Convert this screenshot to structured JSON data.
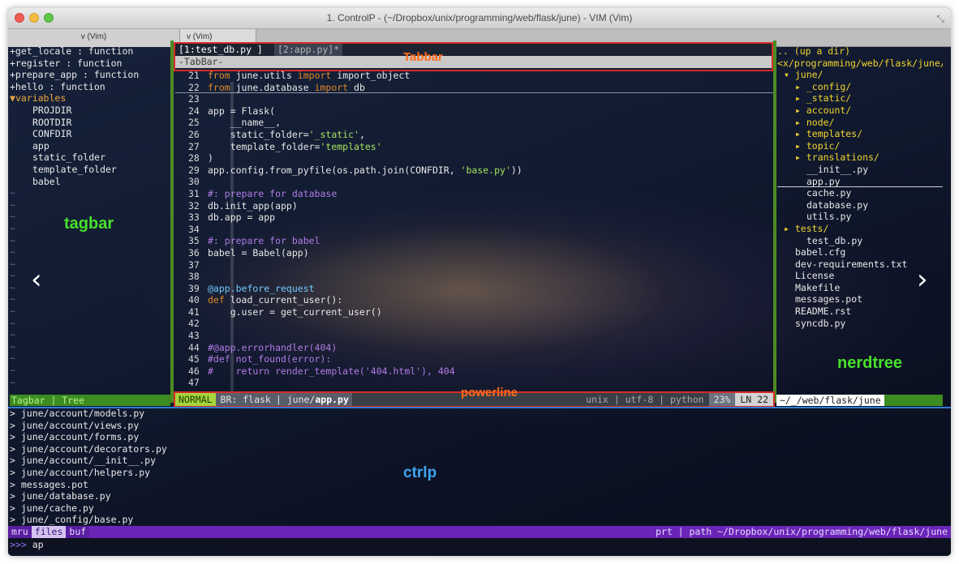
{
  "window": {
    "title": "1. ControlP - (~/Dropbox/unix/programming/web/flask/june) - VIM (Vim)",
    "tabs": [
      "v (Vim)",
      "v (Vim)"
    ]
  },
  "vim_tabs": {
    "active": "[1:test_db.py ]",
    "inactive": "[2:app.py]*",
    "tabbar_line": "-TabBar-"
  },
  "tagbar": {
    "functions": [
      "+get_locale : function",
      "+register : function",
      "+prepare_app : function",
      "+hello : function"
    ],
    "section": "variables",
    "variables": [
      "PROJDIR",
      "ROOTDIR",
      "CONFDIR",
      "app",
      "static_folder",
      "template_folder",
      "babel"
    ],
    "status": "Tagbar | Tree"
  },
  "code_lines": [
    {
      "n": "21",
      "t": "from june.utils import import_object"
    },
    {
      "n": "22",
      "t": "from june.database import db"
    },
    {
      "n": "23",
      "t": ""
    },
    {
      "n": "24",
      "t": "app = Flask("
    },
    {
      "n": "25",
      "t": "    __name__,"
    },
    {
      "n": "26",
      "t": "    static_folder='_static',"
    },
    {
      "n": "27",
      "t": "    template_folder='templates'"
    },
    {
      "n": "28",
      "t": ")"
    },
    {
      "n": "29",
      "t": "app.config.from_pyfile(os.path.join(CONFDIR, 'base.py'))"
    },
    {
      "n": "30",
      "t": ""
    },
    {
      "n": "31",
      "t": "#: prepare for database"
    },
    {
      "n": "32",
      "t": "db.init_app(app)"
    },
    {
      "n": "33",
      "t": "db.app = app"
    },
    {
      "n": "34",
      "t": ""
    },
    {
      "n": "35",
      "t": "#: prepare for babel"
    },
    {
      "n": "36",
      "t": "babel = Babel(app)"
    },
    {
      "n": "37",
      "t": ""
    },
    {
      "n": "38",
      "t": ""
    },
    {
      "n": "39",
      "t": "@app.before_request"
    },
    {
      "n": "40",
      "t": "def load_current_user():"
    },
    {
      "n": "41",
      "t": "    g.user = get_current_user()"
    },
    {
      "n": "42",
      "t": ""
    },
    {
      "n": "43",
      "t": ""
    },
    {
      "n": "44",
      "t": "#@app.errorhandler(404)"
    },
    {
      "n": "45",
      "t": "#def not_found(error):"
    },
    {
      "n": "46",
      "t": "#    return render_template('404.html'), 404"
    },
    {
      "n": "47",
      "t": ""
    }
  ],
  "powerline": {
    "mode": "NORMAL",
    "branch": "BR: flask",
    "file_dir": "june/",
    "file_name": "app.py",
    "encoding_info": "unix | utf-8 | python",
    "percent": "23%",
    "ln": "LN",
    "line_no": "22"
  },
  "nerdtree": {
    "up": ".. (up a dir)",
    "path": "<x/programming/web/flask/june/",
    "items": [
      {
        "t": "▾ june/",
        "k": "dir",
        "indent": 0
      },
      {
        "t": "▸ _config/",
        "k": "dir",
        "indent": 1
      },
      {
        "t": "▸ _static/",
        "k": "dir",
        "indent": 1
      },
      {
        "t": "▸ account/",
        "k": "dir",
        "indent": 1
      },
      {
        "t": "▸ node/",
        "k": "dir",
        "indent": 1
      },
      {
        "t": "▸ templates/",
        "k": "dir",
        "indent": 1
      },
      {
        "t": "▸ topic/",
        "k": "dir",
        "indent": 1
      },
      {
        "t": "▸ translations/",
        "k": "dir",
        "indent": 1
      },
      {
        "t": "__init__.py",
        "k": "file",
        "indent": 2
      },
      {
        "t": "app.py",
        "k": "file",
        "indent": 2,
        "cursor": true
      },
      {
        "t": "cache.py",
        "k": "file",
        "indent": 2
      },
      {
        "t": "database.py",
        "k": "file",
        "indent": 2
      },
      {
        "t": "utils.py",
        "k": "file",
        "indent": 2
      },
      {
        "t": "▸ tests/",
        "k": "dir",
        "indent": 0
      },
      {
        "t": "test_db.py",
        "k": "file",
        "indent": 2
      },
      {
        "t": "babel.cfg",
        "k": "file",
        "indent": 1
      },
      {
        "t": "dev-requirements.txt",
        "k": "file",
        "indent": 1
      },
      {
        "t": "License",
        "k": "file",
        "indent": 1
      },
      {
        "t": "Makefile",
        "k": "file",
        "indent": 1
      },
      {
        "t": "messages.pot",
        "k": "file",
        "indent": 1
      },
      {
        "t": "README.rst",
        "k": "file",
        "indent": 1
      },
      {
        "t": "syncdb.py",
        "k": "file",
        "indent": 1
      }
    ],
    "status": "~/_/web/flask/june"
  },
  "ctrlp": {
    "items": [
      "> june/account/models.py",
      "> june/account/views.py",
      "> june/account/forms.py",
      "> june/account/decorators.py",
      "> june/account/__init__.py",
      "> june/account/helpers.py",
      "> messages.pot",
      "> june/database.py",
      "> june/cache.py",
      "> june/_config/base.py"
    ],
    "modes": [
      "mru",
      "files",
      "buf"
    ],
    "status_right": "prt | path ~/Dropbox/unix/programming/web/flask/june",
    "prompt_chars": ">>>",
    "prompt_text": " ap"
  },
  "annotations": {
    "tabbar": "Tabbar",
    "tagbar": "tagbar",
    "powerline": "powerline",
    "nerdtree": "nerdtree",
    "ctrlp": "ctrlp"
  },
  "colors": {
    "annotation_orange": "#ff6c1a",
    "annotation_green": "#48e02c",
    "annotation_blue": "#3fa4f2",
    "split_green": "#3c8c22",
    "ctrlp_purple": "#6a25b7"
  }
}
